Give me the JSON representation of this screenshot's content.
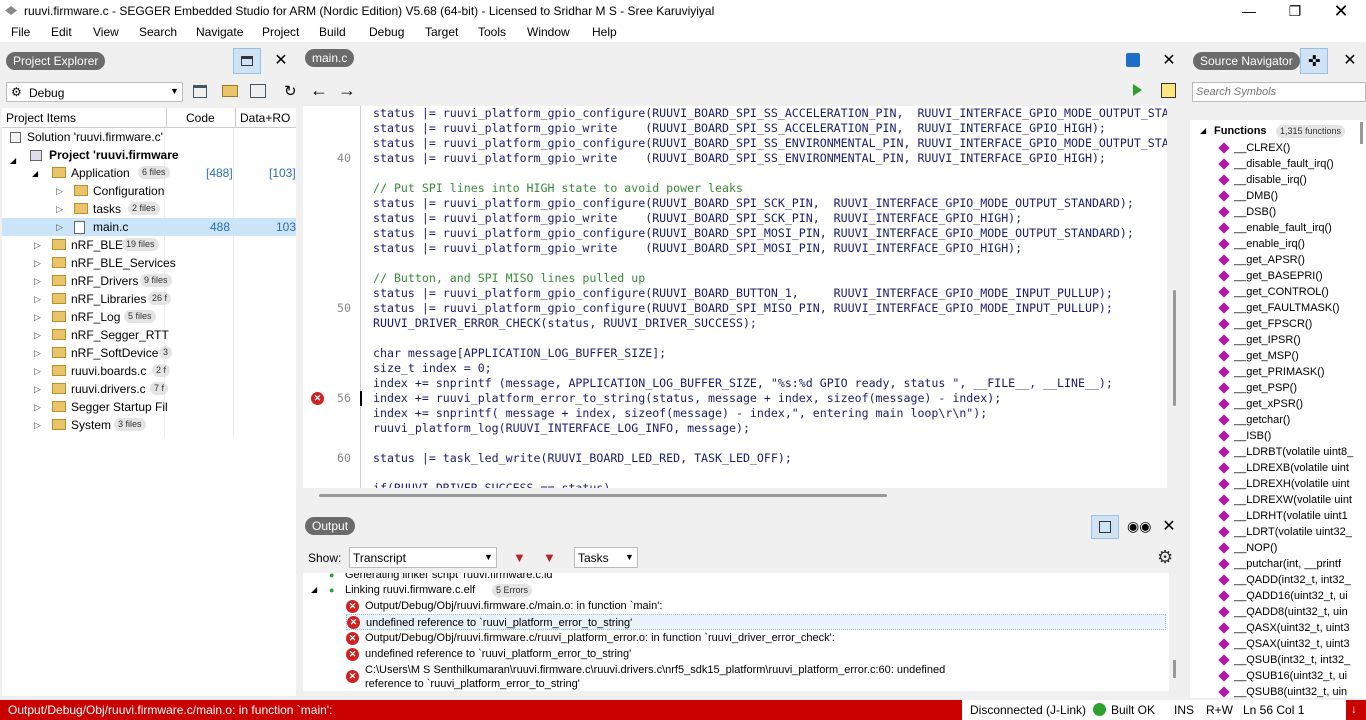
{
  "window": {
    "title": "ruuvi.firmware.c - SEGGER Embedded Studio for ARM (Nordic Edition) V5.68 (64-bit) - Licensed to Sridhar M S - Sree Karuviyiyal"
  },
  "menu": [
    "File",
    "Edit",
    "View",
    "Search",
    "Navigate",
    "Project",
    "Build",
    "Debug",
    "Target",
    "Tools",
    "Window",
    "Help"
  ],
  "project_explorer": {
    "title": "Project Explorer",
    "config": "Debug",
    "columns": [
      "Project Items",
      "Code",
      "Data+RO"
    ],
    "solution": "Solution 'ruuvi.firmware.c'",
    "project": "Project 'ruuvi.firmware",
    "items": [
      {
        "label": "Application",
        "badge": "6 files",
        "code": "[488]",
        "data": "[103]"
      },
      {
        "label": "Configuration",
        "badge": "",
        "code": "",
        "data": ""
      },
      {
        "label": "tasks",
        "badge": "2 files",
        "code": "",
        "data": ""
      },
      {
        "label": "main.c",
        "badge": "",
        "code": "488",
        "data": "103"
      },
      {
        "label": "nRF_BLE",
        "badge": "19 files",
        "code": "",
        "data": ""
      },
      {
        "label": "nRF_BLE_Services",
        "badge": "",
        "code": "",
        "data": ""
      },
      {
        "label": "nRF_Drivers",
        "badge": "9 files",
        "code": "",
        "data": ""
      },
      {
        "label": "nRF_Libraries",
        "badge": "26 f",
        "code": "",
        "data": ""
      },
      {
        "label": "nRF_Log",
        "badge": "5 files",
        "code": "",
        "data": ""
      },
      {
        "label": "nRF_Segger_RTT",
        "badge": "",
        "code": "",
        "data": ""
      },
      {
        "label": "nRF_SoftDevice",
        "badge": "3",
        "code": "",
        "data": ""
      },
      {
        "label": "ruuvi.boards.c",
        "badge": "2 f",
        "code": "",
        "data": ""
      },
      {
        "label": "ruuvi.drivers.c",
        "badge": "7 f",
        "code": "",
        "data": ""
      },
      {
        "label": "Segger Startup File",
        "badge": "",
        "code": "",
        "data": ""
      },
      {
        "label": "System",
        "badge": "3 files",
        "code": "",
        "data": ""
      }
    ]
  },
  "editor": {
    "tab": "main.c",
    "lines": [
      {
        "n": "",
        "text": "status |= ruuvi_platform_gpio_configure(RUUVI_BOARD_SPI_SS_ACCELERATION_PIN,  RUUVI_INTERFACE_GPIO_MODE_OUTPUT_STA"
      },
      {
        "n": "",
        "text": "status |= ruuvi_platform_gpio_write    (RUUVI_BOARD_SPI_SS_ACCELERATION_PIN,  RUUVI_INTERFACE_GPIO_HIGH);"
      },
      {
        "n": "",
        "text": "status |= ruuvi_platform_gpio_configure(RUUVI_BOARD_SPI_SS_ENVIRONMENTAL_PIN, RUUVI_INTERFACE_GPIO_MODE_OUTPUT_STA"
      },
      {
        "n": "40",
        "text": "status |= ruuvi_platform_gpio_write    (RUUVI_BOARD_SPI_SS_ENVIRONMENTAL_PIN, RUUVI_INTERFACE_GPIO_HIGH);"
      },
      {
        "n": "",
        "text": ""
      },
      {
        "n": "",
        "text": "// Put SPI lines into HIGH state to avoid power leaks"
      },
      {
        "n": "",
        "text": "status |= ruuvi_platform_gpio_configure(RUUVI_BOARD_SPI_SCK_PIN,  RUUVI_INTERFACE_GPIO_MODE_OUTPUT_STANDARD);"
      },
      {
        "n": "",
        "text": "status |= ruuvi_platform_gpio_write    (RUUVI_BOARD_SPI_SCK_PIN,  RUUVI_INTERFACE_GPIO_HIGH);"
      },
      {
        "n": "",
        "text": "status |= ruuvi_platform_gpio_configure(RUUVI_BOARD_SPI_MOSI_PIN, RUUVI_INTERFACE_GPIO_MODE_OUTPUT_STANDARD);"
      },
      {
        "n": "",
        "text": "status |= ruuvi_platform_gpio_write    (RUUVI_BOARD_SPI_MOSI_PIN, RUUVI_INTERFACE_GPIO_HIGH);"
      },
      {
        "n": "",
        "text": ""
      },
      {
        "n": "",
        "text": "// Button, and SPI MISO lines pulled up"
      },
      {
        "n": "",
        "text": "status |= ruuvi_platform_gpio_configure(RUUVI_BOARD_BUTTON_1,     RUUVI_INTERFACE_GPIO_MODE_INPUT_PULLUP);"
      },
      {
        "n": "50",
        "text": "status |= ruuvi_platform_gpio_configure(RUUVI_BOARD_SPI_MISO_PIN, RUUVI_INTERFACE_GPIO_MODE_INPUT_PULLUP);"
      },
      {
        "n": "",
        "text": "RUUVI_DRIVER_ERROR_CHECK(status, RUUVI_DRIVER_SUCCESS);"
      },
      {
        "n": "",
        "text": ""
      },
      {
        "n": "",
        "text": "char message[APPLICATION_LOG_BUFFER_SIZE];"
      },
      {
        "n": "",
        "text": "size_t index = 0;"
      },
      {
        "n": "",
        "text": "index += snprintf (message, APPLICATION_LOG_BUFFER_SIZE, \"%s:%d GPIO ready, status \", __FILE__, __LINE__);"
      },
      {
        "n": "56",
        "text": "index += ruuvi_platform_error_to_string(status, message + index, sizeof(message) - index);"
      },
      {
        "n": "",
        "text": "index += snprintf( message + index, sizeof(message) - index,\", entering main loop\\r\\n\");"
      },
      {
        "n": "",
        "text": "ruuvi_platform_log(RUUVI_INTERFACE_LOG_INFO, message);"
      },
      {
        "n": "",
        "text": ""
      },
      {
        "n": "60",
        "text": "status |= task_led_write(RUUVI_BOARD_LED_RED, TASK_LED_OFF);"
      },
      {
        "n": "",
        "text": ""
      },
      {
        "n": "",
        "text": "if(RUUVI_DRIVER_SUCCESS == status)"
      }
    ]
  },
  "output": {
    "title": "Output",
    "show_label": "Show:",
    "show_value": "Transcript",
    "tasks_value": "Tasks",
    "rows": [
      {
        "text": "Generating linker script 'ruuvi.firmware.c.ld'",
        "kind": "ok"
      },
      {
        "text": "Linking ruuvi.firmware.c.elf",
        "badge": "5 Errors",
        "kind": "group"
      },
      {
        "text": "Output/Debug/Obj/ruuvi.firmware.c/main.o: in function `main':",
        "kind": "err"
      },
      {
        "text": "undefined reference to `ruuvi_platform_error_to_string'",
        "kind": "err"
      },
      {
        "text": "Output/Debug/Obj/ruuvi.firmware.c/ruuvi_platform_error.o: in function `ruuvi_driver_error_check':",
        "kind": "err"
      },
      {
        "text": "undefined reference to `ruuvi_platform_error_to_string'",
        "kind": "err"
      },
      {
        "text": "C:\\Users\\M S Senthilkumaran\\ruuvi.firmware.c\\ruuvi.drivers.c\\nrf5_sdk15_platform\\ruuvi_platform_error.c:60: undefined",
        "kind": "err"
      },
      {
        "text": "reference to `ruuvi_platform_error_to_string'",
        "kind": "cont"
      }
    ]
  },
  "source_navigator": {
    "title": "Source Navigator",
    "search_placeholder": "Search Symbols",
    "group": "Functions",
    "group_badge": "1,315 functions",
    "symbols": [
      "__CLREX()",
      "__disable_fault_irq()",
      "__disable_irq()",
      "__DMB()",
      "__DSB()",
      "__enable_fault_irq()",
      "__enable_irq()",
      "__get_APSR()",
      "__get_BASEPRI()",
      "__get_CONTROL()",
      "__get_FAULTMASK()",
      "__get_FPSCR()",
      "__get_IPSR()",
      "__get_MSP()",
      "__get_PRIMASK()",
      "__get_PSP()",
      "__get_xPSR()",
      "__getchar()",
      "__ISB()",
      "__LDRBT(volatile uint8_",
      "__LDREXB(volatile uint",
      "__LDREXH(volatile uint",
      "__LDREXW(volatile uint",
      "__LDRHT(volatile uint1",
      "__LDRT(volatile uint32_",
      "__NOP()",
      "__putchar(int, __printf",
      "__QADD(int32_t, int32_",
      "__QADD16(uint32_t, ui",
      "__QADD8(uint32_t, uin",
      "__QASX(uint32_t, uint3",
      "__QSAX(uint32_t, uint3",
      "__QSUB(int32_t, int32_",
      "__QSUB16(uint32_t, ui",
      "__QSUB8(uint32_t, uin"
    ]
  },
  "status_bar": {
    "message": "Output/Debug/Obj/ruuvi.firmware.c/main.o: in function `main':",
    "connection": "Disconnected (J-Link)",
    "build": "Built OK",
    "ins": "INS",
    "rw": "R+W",
    "position": "Ln 56 Col 1"
  },
  "colors": {
    "error_red": "#c80000",
    "chip_gray": "#6b6b6b",
    "selection_blue": "#cce4f7"
  }
}
